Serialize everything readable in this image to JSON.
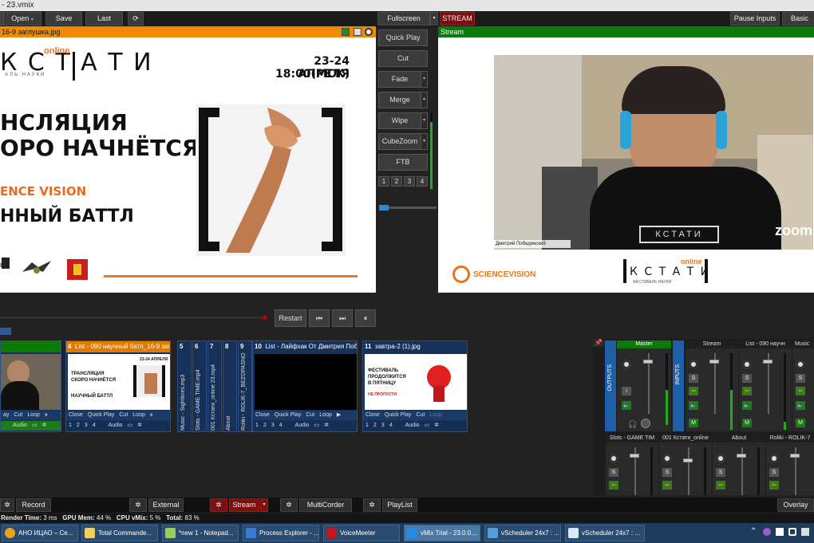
{
  "window": {
    "title": "- 23.vmix"
  },
  "menu": {
    "open": "Open",
    "save": "Save",
    "last": "Last",
    "fullscreen": "Fullscreen",
    "stream_label": "STREAM 1",
    "pause_inputs": "Pause Inputs",
    "basic": "Basic"
  },
  "preview": {
    "title": "16-9 заглушка.jpg",
    "logo_text": "К С Т А Т И",
    "logo_online": "online",
    "logo_sub": "АЛЬ НАУКИ",
    "date": "23-24 АПРЕЛЯ",
    "time": "18:00(МСК)",
    "line1": "НСЛЯЦИЯ",
    "line2": "ОРО НАЧНЁТСЯ",
    "orange": "ENCE VISION",
    "line3": "ННЫЙ БАТТЛ",
    "logo_small": "us"
  },
  "transitions": {
    "quick_play": "Quick Play",
    "cut": "Cut",
    "fade": "Fade",
    "merge": "Merge",
    "wipe": "Wipe",
    "cubezoom": "CubeZoom",
    "ftb": "FTB",
    "numbers": [
      "1",
      "2",
      "3",
      "4"
    ]
  },
  "output": {
    "title": "Stream",
    "name_tag": "Дмитрий Побединский",
    "zoom": "zoom",
    "sv_brand": "SCIENCEVISION",
    "logo_text": "К С Т А Т И",
    "logo_online": "online",
    "logo_sub": "ФЕСТИВАЛЬ НАУКИ"
  },
  "transport": {
    "restart": "Restart",
    "prev_icon": "skip-back-icon",
    "next_icon": "skip-forward-icon",
    "pause_icon": "pause-icon"
  },
  "tiles": [
    {
      "num": "",
      "title": "",
      "controls": [
        "ay",
        "Cut",
        "Loop"
      ],
      "bottom": "Audio"
    },
    {
      "num": "4",
      "title": "List - 090 научный батл_16-9 заглуш",
      "controls": [
        "Close",
        "Quick Play",
        "Cut",
        "Loop"
      ],
      "numbers": [
        "1",
        "2",
        "3",
        "4"
      ],
      "bottom": "Audio",
      "thumb_line1": "ТРАНСЛЯЦИЯ",
      "thumb_line2": "СКОРО НАЧНЁТСЯ",
      "thumb_line3": "НАУЧНЫЙ БАТТЛ",
      "thumb_date": "23-24 АПРЕЛЯ"
    },
    {
      "num": "5",
      "vtitle": "Music - Sightlines.mp3"
    },
    {
      "num": "6",
      "vtitle": "Slots - GAME TIME.mp4"
    },
    {
      "num": "7",
      "vtitle": "001 Кстати_online 23.mp4"
    },
    {
      "num": "8",
      "vtitle": "About"
    },
    {
      "num": "9",
      "vtitle": "Roliki - ROLIK-7_BEZOPASNO"
    },
    {
      "num": "10",
      "title": "List - Лайфхак От Дмитрия Победи",
      "controls": [
        "Close",
        "Quick Play",
        "Cut",
        "Loop"
      ],
      "numbers": [
        "1",
        "2",
        "3",
        "4"
      ],
      "bottom": "Audio"
    },
    {
      "num": "11",
      "title": "завтра-2 (1).jpg",
      "controls": [
        "Close",
        "Quick Play",
        "Cut",
        "Loop"
      ],
      "numbers": [
        "1",
        "2",
        "3",
        "4"
      ],
      "bottom": "Audio",
      "thumb_line1": "ФЕСТИВАЛЬ",
      "thumb_line2": "ПРОДОЛЖИТСЯ",
      "thumb_line3": "В ПЯТНИЦУ",
      "thumb_small": "НЕ ПРОПУСТИ"
    }
  ],
  "mixer": {
    "outputs_label": "OUTPUTS",
    "inputs_label": "INPUTS",
    "master": "Master",
    "strips_top": [
      "Stream",
      "List - 090 научн",
      "Music"
    ],
    "strips_bottom": [
      "Slots - GAME TIM",
      "001 Кстати_online",
      "About",
      "Roliki - ROLIK-7"
    ],
    "s": "S",
    "m": "M",
    "i": "i"
  },
  "actionbar": {
    "record": "Record",
    "external": "External",
    "stream": "Stream",
    "multicorder": "MultiCorder",
    "playlist": "PlayList",
    "overlay": "Overlay"
  },
  "status": {
    "render_label": "Render Time:",
    "render_val": "3 ms",
    "gpu_label": "GPU Mem:",
    "gpu_val": "44 %",
    "cpu_label": "CPU vMix:",
    "cpu_val": "5 %",
    "total_label": "Total:",
    "total_val": "83 %"
  },
  "taskbar": {
    "items": [
      "АНО ИЦАО – Се...",
      "Total Commande...",
      "*new 1 - Notepad...",
      "Process Explorer - ...",
      "VoiceMeeter",
      "vMix Trial - 23.0.0....",
      "vScheduler 24x7 : ...",
      "vScheduler 24x7 : ..."
    ],
    "tray_icon": "chevron-up-icon"
  },
  "colors": {
    "accent_orange": "#f08a00",
    "stream_green": "#0b7a0b",
    "tile_blue": "#15315a",
    "record_red": "#7a1010"
  }
}
